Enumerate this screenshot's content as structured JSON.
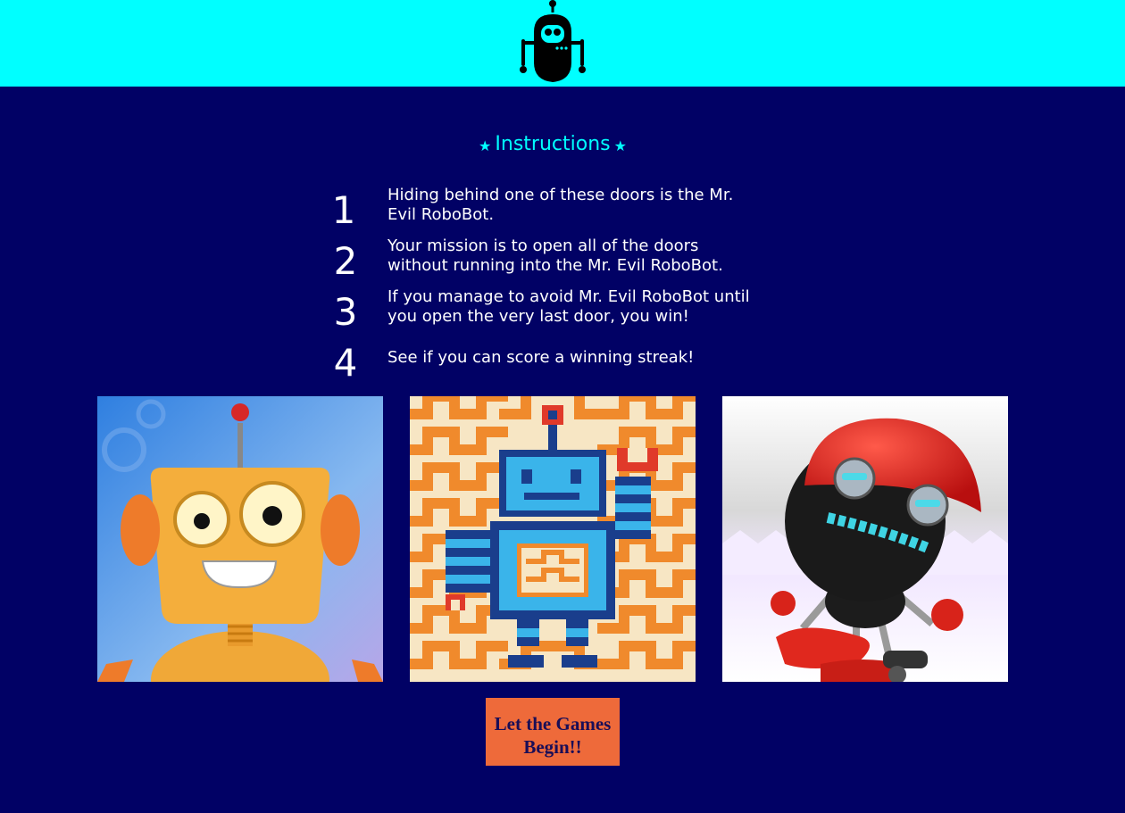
{
  "header": {
    "logo_icon": "robot-icon",
    "background": "#00ffff"
  },
  "instructions": {
    "title": "Instructions",
    "star_left": "★",
    "star_right": "★",
    "steps": [
      {
        "number": "1",
        "text": "Hiding behind one of these doors is the Mr. Evil RoboBot."
      },
      {
        "number": "2",
        "text": "Your mission is to open all of the doors without running into the Mr. Evil RoboBot."
      },
      {
        "number": "3",
        "text": "If you manage to avoid Mr. Evil RoboBot until you open the very last door, you win!"
      },
      {
        "number": "4",
        "text": "See if you can score a winning streak!"
      }
    ]
  },
  "doors": [
    {
      "icon": "orange-robot-image"
    },
    {
      "icon": "quilt-robot-image"
    },
    {
      "icon": "red-helmet-robot-image"
    }
  ],
  "start_button": {
    "label": "Let the Games Begin!!"
  },
  "colors": {
    "page_bg": "#010165",
    "accent": "#00ffff",
    "button_bg": "#ee6a3a",
    "button_text": "#1a0e57"
  }
}
